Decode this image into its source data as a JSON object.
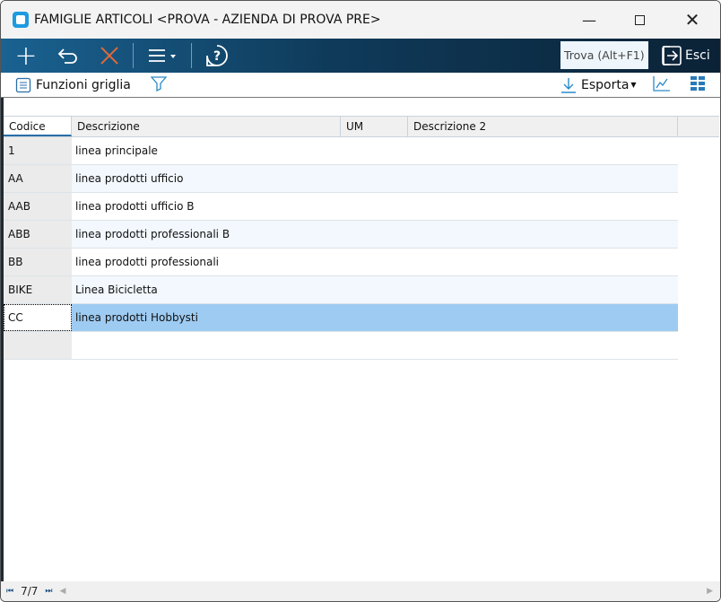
{
  "window": {
    "title": "FAMIGLIE ARTICOLI <PROVA - AZIENDA DI PROVA PRE>"
  },
  "toolbar": {
    "find_placeholder": "Trova (Alt+F1)",
    "exit_label": "Esci"
  },
  "subbar": {
    "grid_functions": "Funzioni griglia",
    "export": "Esporta"
  },
  "grid": {
    "columns": [
      "Codice",
      "Descrizione",
      "UM",
      "Descrizione 2"
    ],
    "rows": [
      {
        "codice": "1",
        "descrizione": "linea principale"
      },
      {
        "codice": "AA",
        "descrizione": "linea prodotti ufficio"
      },
      {
        "codice": "AAB",
        "descrizione": "linea prodotti ufficio B"
      },
      {
        "codice": "ABB",
        "descrizione": "linea prodotti professionali B"
      },
      {
        "codice": "BB",
        "descrizione": "linea prodotti professionali"
      },
      {
        "codice": "BIKE",
        "descrizione": "Linea Bicicletta"
      },
      {
        "codice": "CC",
        "descrizione": "linea prodotti Hobbysti"
      }
    ]
  },
  "footer": {
    "record_counter": "7/7"
  }
}
